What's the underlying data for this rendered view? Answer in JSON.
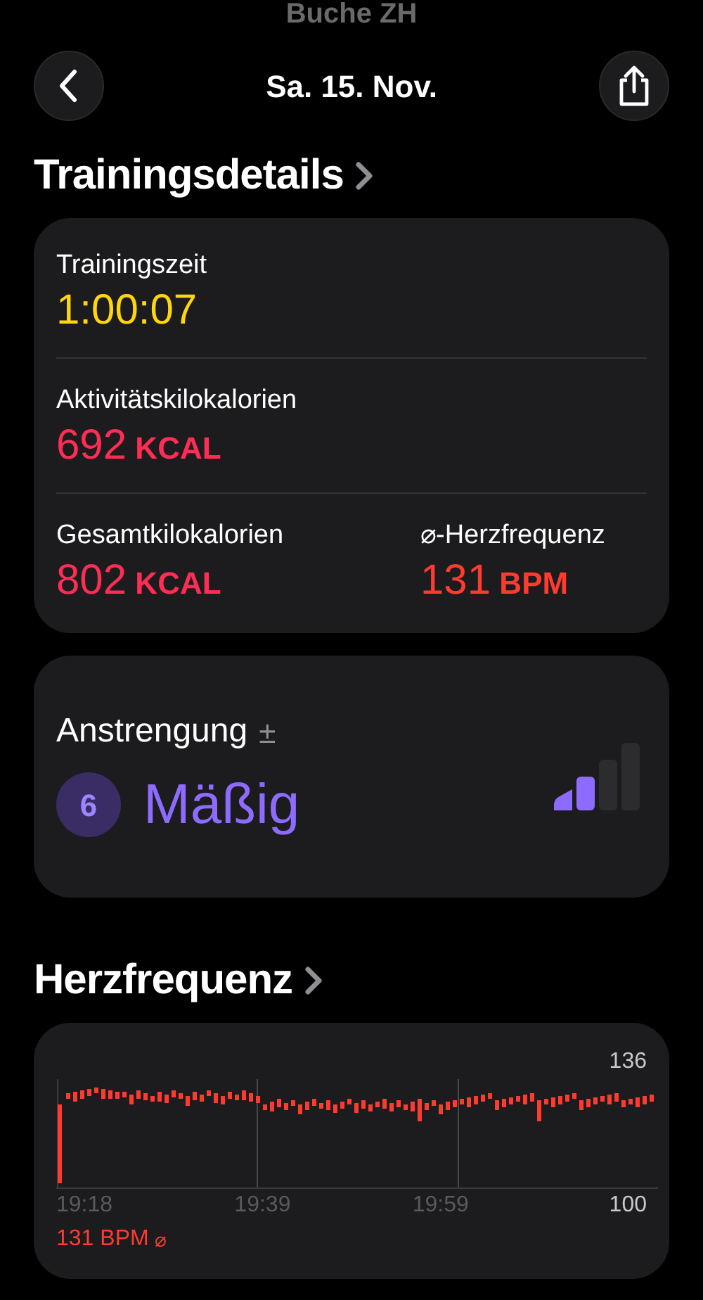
{
  "background": {
    "location": "Buche ZH"
  },
  "nav": {
    "title": "Sa. 15. Nov."
  },
  "details": {
    "heading": "Trainingsdetails",
    "metrics": [
      {
        "label": "Trainingszeit",
        "value": "1:00:07",
        "color": "#ffd60a"
      },
      {
        "label": "Aktivitätskilokalorien",
        "value": "692",
        "unit": "KCAL",
        "color": "#ff2d55"
      },
      {
        "label": "Gesamtkilokalorien",
        "value": "802",
        "unit": "KCAL",
        "color": "#ff2d55"
      },
      {
        "label": "⌀-Herzfrequenz",
        "value": "131",
        "unit": "BPM",
        "color": "#ff3b30"
      }
    ]
  },
  "effort": {
    "label": "Anstrengung",
    "symbol": "±",
    "score": "6",
    "rating": "Mäßig",
    "bars": [
      {
        "filled": true
      },
      {
        "filled": true
      },
      {
        "filled": false
      },
      {
        "filled": false
      }
    ]
  },
  "heart_rate": {
    "heading": "Herzfrequenz",
    "max_label": "136",
    "min_label": "100",
    "times": [
      "19:18",
      "19:39",
      "19:59"
    ],
    "average": "131 BPM",
    "average_symbol": "⌀"
  }
}
